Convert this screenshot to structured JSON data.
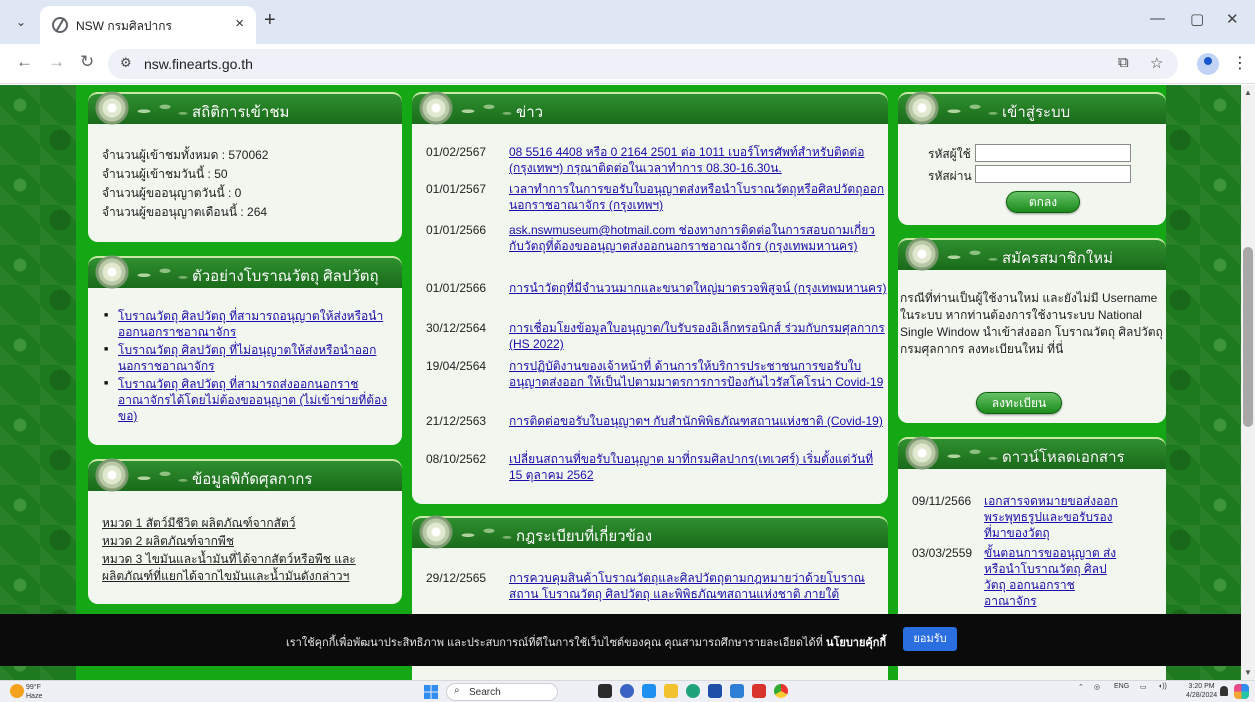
{
  "browser": {
    "tab_title": "NSW กรมศิลปากร",
    "url": "nsw.finearts.go.th",
    "new_tab_glyph": "+",
    "close_glyph": "×"
  },
  "panels": {
    "stats": {
      "title": "สถิติการเข้าชม",
      "lines": [
        "จำนวนผู้เข้าชมทั้งหมด : 570062",
        "จำนวนผู้เข้าชมวันนี้ : 50",
        "จำนวนผู้ขออนุญาตวันนี้ : 0",
        "จำนวนผู้ขออนุญาตเดือนนี้ : 264"
      ]
    },
    "examples": {
      "title": "ตัวอย่างโบราณวัตถุ ศิลปวัตถุ",
      "items": [
        "โบราณวัตถุ ศิลปวัตถุ ที่สามารถอนุญาตให้ส่งหรือนำออกนอกราชอาณาจักร",
        "โบราณวัตถุ ศิลปวัตถุ ที่ไม่อนุญาตให้ส่งหรือนำออกนอกราชอาณาจักร",
        "โบราณวัตถุ ศิลปวัตถุ ที่สามารถส่งออกนอกราชอาณาจักรได้โดยไม่ต้องขออนุญาต (ไม่เข้าข่ายที่ต้องขอ)"
      ]
    },
    "tariff": {
      "title": "ข้อมูลพิกัดศุลกากร",
      "items": [
        "หมวด 1 สัตว์มีชีวิต ผลิตภัณฑ์จากสัตว์",
        "หมวด 2 ผลิตภัณฑ์จากพืช",
        "หมวด 3 ไขมันและน้ำมันที่ได้จากสัตว์หรือพืช และผลิตภัณฑ์ที่แยกได้จากไขมันและน้ำมันดังกล่าวฯ"
      ]
    },
    "news": {
      "title": "ข่าว",
      "items": [
        {
          "date": "01/02/2567",
          "text": "08 5516 4408 หรือ 0 2164 2501 ต่อ 1011 เบอร์โทรศัพท์สำหรับติดต่อ (กรุงเทพฯ) กรุณาติดต่อในเวลาทำการ 08.30-16.30น."
        },
        {
          "date": "01/01/2567",
          "text": "เวลาทำการในการขอรับใบอนุญาตส่งหรือนำโบราณวัตถุหรือศิลปวัตถุออกนอกราชอาณาจักร (กรุงเทพฯ)"
        },
        {
          "date": "01/01/2566",
          "text": "ask.nswmuseum@hotmail.com ช่องทางการติดต่อในการสอบถามเกี่ยวกับวัตถุที่ต้องขออนุญาตส่งออกนอกราชอาณาจักร (กรุงเทพมหานคร)"
        },
        {
          "date": "01/01/2566",
          "text": "การนำวัตถุที่มีจำนวนมากและขนาดใหญ่มาตรวจพิสูจน์ (กรุงเทพมหานคร)"
        },
        {
          "date": "30/12/2564",
          "text": "การเชื่อมโยงข้อมูลใบอนุญาต/ใบรับรองอิเล็กทรอนิกส์ ร่วมกับกรมศุลกากร (HS 2022)"
        },
        {
          "date": "19/04/2564",
          "text": "การปฏิบัติงานของเจ้าหน้าที่ ด้านการให้บริการประชาชนการขอรับใบอนุญาตส่งออก ให้เป็นไปตามมาตรการการป้องกันไวรัสโคโรน่า Covid-19"
        },
        {
          "date": "21/12/2563",
          "text": "การติดต่อขอรับใบอนุญาตฯ กับสำนักพิพิธภัณฑสถานแห่งชาติ (Covid-19)"
        },
        {
          "date": "08/10/2562",
          "text": "เปลี่ยนสถานที่ขอรับใบอนุญาต มาที่กรมศิลปากร(เทเวศร์) เริ่มตั้งแต่วันที่ 15 ตุลาคม 2562"
        }
      ]
    },
    "regulations": {
      "title": "กฎระเบียบที่เกี่ยวข้อง",
      "items": [
        {
          "date": "29/12/2565",
          "text": "การควบคุมสินค้าโบราณวัตถุและศิลปวัตถุตามกฎหมายว่าด้วยโบราณสถาน โบราณวัตถุ ศิลปวัตถุ และพิพิธภัณฑสถานแห่งชาติ ภายใต้"
        }
      ]
    },
    "login": {
      "title": "เข้าสู่ระบบ",
      "user_label": "รหัสผู้ใช้",
      "pass_label": "รหัสผ่าน",
      "submit": "ตกลง"
    },
    "register": {
      "title": "สมัครสมาชิกใหม่",
      "text": "กรณีที่ท่านเป็นผู้ใช้งานใหม่ และยังไม่มี Username ในระบบ หากท่านต้องการใช้งานระบบ National Single Window นำเข้าส่งออก โบราณวัตถุ ศิลปวัตถุ กรมศุลกากร ลงทะเบียนใหม่ ที่นี่",
      "button": "ลงทะเบียน"
    },
    "downloads": {
      "title": "ดาวน์โหลดเอกสาร",
      "items": [
        {
          "date": "09/11/2566",
          "text": "เอกสารจดหมายขอส่งออกพระพุทธรูปและขอรับรองที่มาของวัตถุ"
        },
        {
          "date": "03/03/2559",
          "text": "ขั้นตอนการขออนุญาต ส่งหรือนำโบราณวัตถุ ศิลปวัตถุ ออกนอกราชอาณาจักร"
        }
      ]
    }
  },
  "cookie": {
    "text": "เราใช้คุกกี้เพื่อพัฒนาประสิทธิภาพ และประสบการณ์ที่ดีในการใช้เว็บไซต์ของคุณ คุณสามารถศึกษารายละเอียดได้ที่ ",
    "policy": "นโยบายคุ้กกี้",
    "accept": "ยอมรับ"
  },
  "taskbar": {
    "weather_temp": "99°F",
    "weather_desc": "Haze",
    "search": "Search",
    "lang": "ENG",
    "time": "3:20 PM",
    "date": "4/28/2024"
  }
}
